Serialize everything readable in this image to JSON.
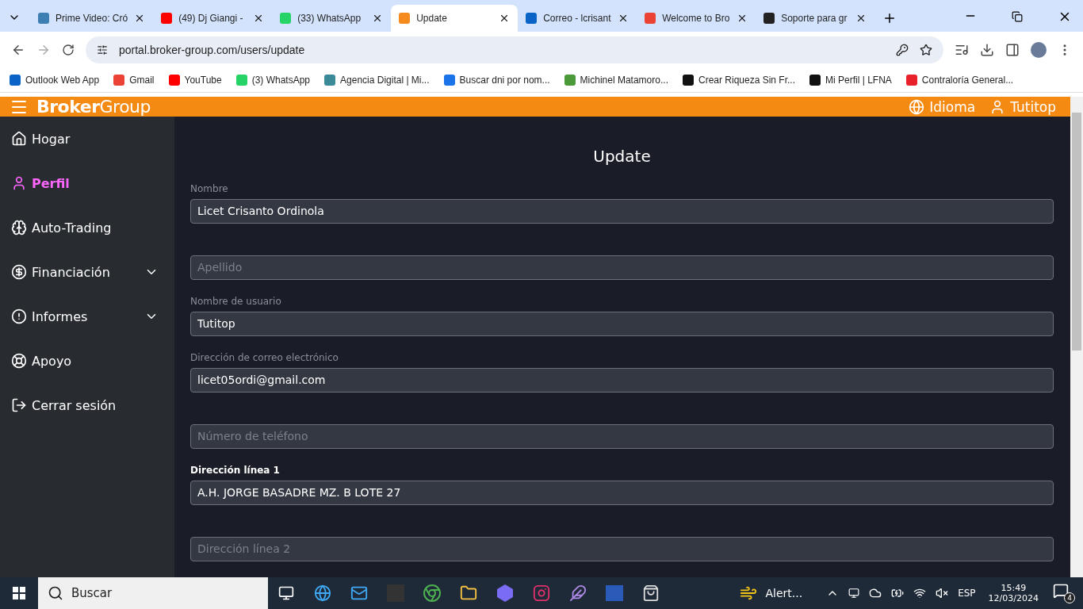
{
  "browser": {
    "tabs": [
      {
        "title": "Prime Video: Cró",
        "selected": false,
        "color": "#3d7fb3"
      },
      {
        "title": "(49) Dj Giangi -",
        "selected": false,
        "color": "#ff0000"
      },
      {
        "title": "(33) WhatsApp",
        "selected": false,
        "color": "#25d366"
      },
      {
        "title": "Update",
        "selected": true,
        "color": "#f58a1f"
      },
      {
        "title": "Correo - lcrisant",
        "selected": false,
        "color": "#0a64c8"
      },
      {
        "title": "Welcome to Bro",
        "selected": false,
        "color": "#ea4335"
      },
      {
        "title": "Soporte para gr",
        "selected": false,
        "color": "#222222"
      }
    ],
    "url": "portal.broker-group.com/users/update",
    "bookmarks": [
      {
        "label": "Outlook Web App",
        "color": "#0a64c8"
      },
      {
        "label": "Gmail",
        "color": "#ea4335"
      },
      {
        "label": "YouTube",
        "color": "#ff0000"
      },
      {
        "label": "(3) WhatsApp",
        "color": "#25d366"
      },
      {
        "label": "Agencia Digital | Mi...",
        "color": "#3a8a9a"
      },
      {
        "label": "Buscar dni por nom...",
        "color": "#1a73e8"
      },
      {
        "label": "Michinel Matamoro...",
        "color": "#4a9a3a"
      },
      {
        "label": "Crear Riqueza Sin Fr...",
        "color": "#111111"
      },
      {
        "label": "Mi Perfil | LFNA",
        "color": "#111111"
      },
      {
        "label": "Contraloría General...",
        "color": "#e8202a"
      }
    ]
  },
  "header": {
    "logo": "**Broker**Group",
    "language": "Idioma",
    "user": "Tutitop"
  },
  "sidebar": {
    "items": [
      {
        "label": "Hogar",
        "selected": false
      },
      {
        "label": "Perfil",
        "selected": true
      },
      {
        "label": "Auto-Trading",
        "selected": false
      },
      {
        "label": "Financiación",
        "selected": false,
        "expandable": true
      },
      {
        "label": "Informes",
        "selected": false,
        "expandable": true
      },
      {
        "label": "Apoyo",
        "selected": false
      },
      {
        "label": "Cerrar sesión",
        "selected": false
      }
    ]
  },
  "form": {
    "title": "Update",
    "fields": [
      {
        "label": "Nombre",
        "bold": false,
        "value": "Licet Crisanto Ordinola"
      },
      {
        "placeholder": "Apellido"
      },
      {
        "label": "Nombre de usuario",
        "bold": false,
        "value": "Tutitop"
      },
      {
        "label": "Dirección de correo electrónico",
        "bold": false,
        "value": "licet05ordi@gmail.com"
      },
      {
        "placeholder": "Número de teléfono"
      },
      {
        "label": "Dirección línea 1",
        "bold": true,
        "value": "A.H. JORGE BASADRE MZ. B LOTE 27"
      },
      {
        "placeholder": "Dirección línea 2"
      }
    ]
  },
  "taskbar": {
    "search": "Buscar",
    "weather": "Alert...",
    "language": "ESP",
    "time": "15:49",
    "date": "12/03/2024",
    "notifications": "4"
  }
}
